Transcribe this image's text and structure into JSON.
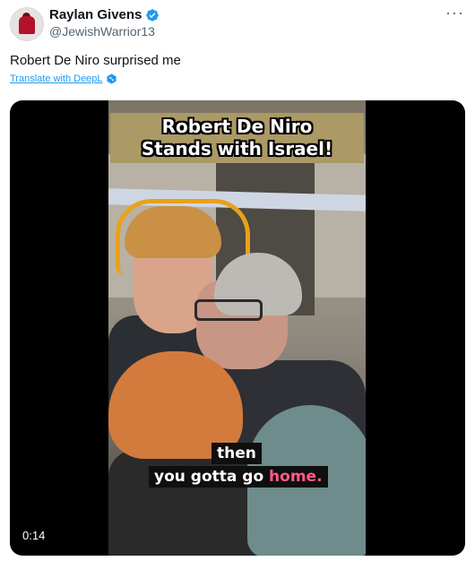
{
  "tweet": {
    "display_name": "Raylan Givens",
    "handle": "@JewishWarrior13",
    "text": "Robert De Niro surprised me",
    "translate_label": "Translate with DeepL",
    "more_label": "···"
  },
  "video": {
    "title_line1": "Robert De Niro",
    "title_line2": "Stands with Israel!",
    "caption_line1": "then",
    "caption_line2_part1": "you gotta go ",
    "caption_line2_highlight": "home.",
    "timestamp": "0:14"
  },
  "colors": {
    "verified": "#1d9bf0",
    "link": "#1d9bf0",
    "caption_highlight": "#ff5b8a",
    "title_bg": "#ab9966"
  },
  "icons": {
    "verified": "verified-badge-icon",
    "deepl": "deepl-icon",
    "more": "more-options-icon"
  }
}
